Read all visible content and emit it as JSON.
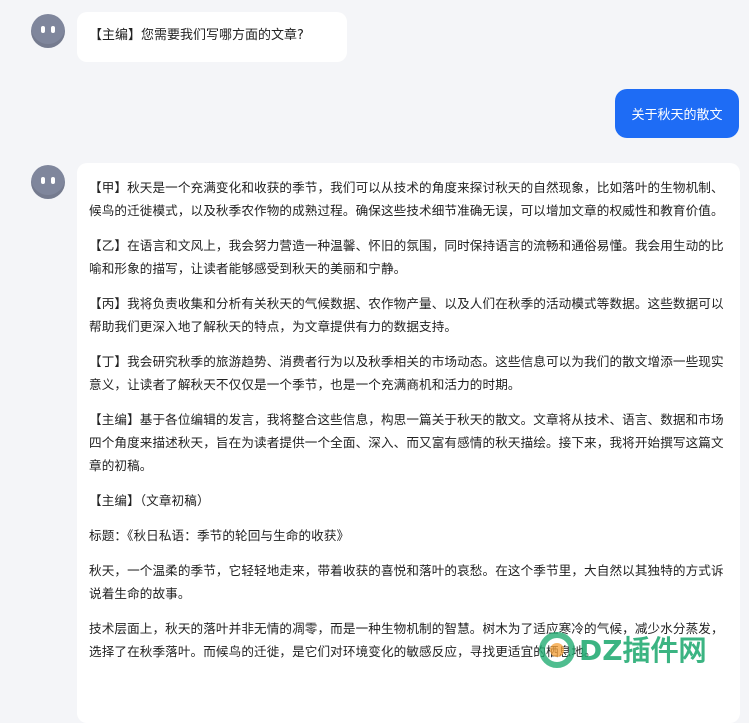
{
  "chat": {
    "q1": "【主编】您需要我们写哪方面的文章?",
    "user1": "关于秋天的散文",
    "answer": {
      "p1": "【甲】秋天是一个充满变化和收获的季节，我们可以从技术的角度来探讨秋天的自然现象，比如落叶的生物机制、候鸟的迁徙模式，以及秋季农作物的成熟过程。确保这些技术细节准确无误，可以增加文章的权威性和教育价值。",
      "p2": "【乙】在语言和文风上，我会努力营造一种温馨、怀旧的氛围，同时保持语言的流畅和通俗易懂。我会用生动的比喻和形象的描写，让读者能够感受到秋天的美丽和宁静。",
      "p3": "【丙】我将负责收集和分析有关秋天的气候数据、农作物产量、以及人们在秋季的活动模式等数据。这些数据可以帮助我们更深入地了解秋天的特点，为文章提供有力的数据支持。",
      "p4": "【丁】我会研究秋季的旅游趋势、消费者行为以及秋季相关的市场动态。这些信息可以为我们的散文增添一些现实意义，让读者了解秋天不仅仅是一个季节，也是一个充满商机和活力的时期。",
      "p5": "【主编】基于各位编辑的发言，我将整合这些信息，构思一篇关于秋天的散文。文章将从技术、语言、数据和市场四个角度来描述秋天，旨在为读者提供一个全面、深入、而又富有感情的秋天描绘。接下来，我将开始撰写这篇文章的初稿。",
      "p6": "【主编】（文章初稿）",
      "p7": "标题：《秋日私语：季节的轮回与生命的收获》",
      "p8": "秋天，一个温柔的季节，它轻轻地走来，带着收获的喜悦和落叶的哀愁。在这个季节里，大自然以其独特的方式诉说着生命的故事。",
      "p9": "技术层面上，秋天的落叶并非无情的凋零，而是一种生物机制的智慧。树木为了适应寒冷的气候，减少水分蒸发，选择了在秋季落叶。而候鸟的迁徙，是它们对环境变化的敏感反应，寻找更适宜的栖息地。"
    }
  },
  "watermark": {
    "text": "DZ插件网"
  },
  "colors": {
    "background": "#f4f5f8",
    "user_bubble": "#1e6cf5",
    "avatar": "#7f869c",
    "watermark": "#1aa86d"
  },
  "icons": [
    "bot-avatar-icon",
    "watermark-logo-icon"
  ]
}
